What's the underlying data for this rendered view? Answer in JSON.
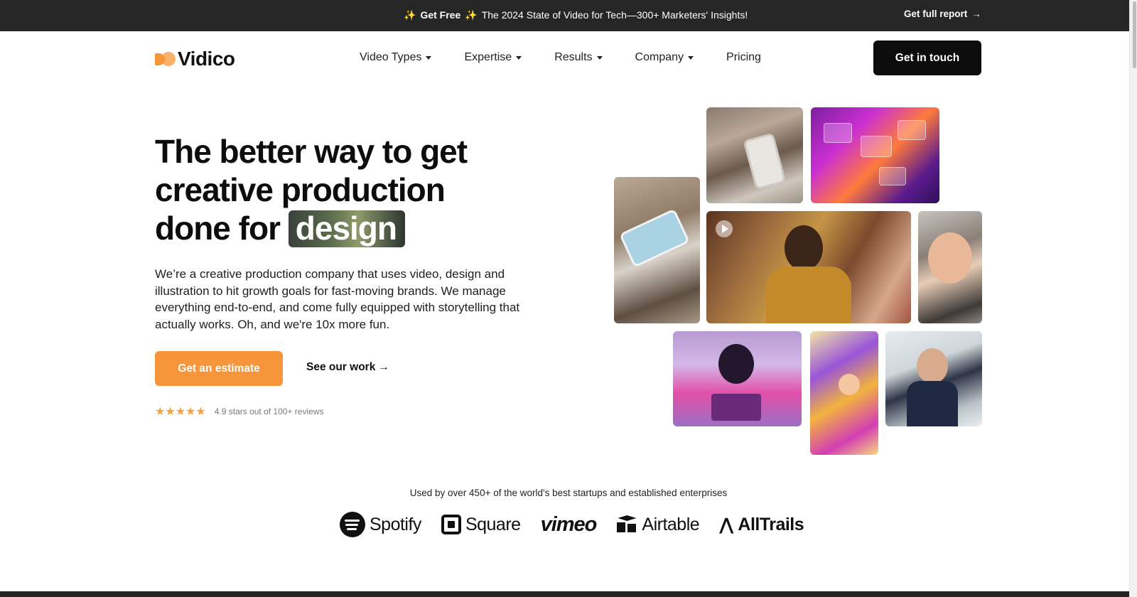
{
  "announcement": {
    "sparkle": "✨",
    "bold": "Get Free",
    "text": "The 2024 State of Video for Tech—300+ Marketers' Insights!",
    "link_label": "Get full report",
    "link_arrow": "→"
  },
  "brand": {
    "name": "Vidico",
    "accent_color": "#f7953b"
  },
  "nav": {
    "items": [
      {
        "label": "Video Types",
        "has_dropdown": true
      },
      {
        "label": "Expertise",
        "has_dropdown": true
      },
      {
        "label": "Results",
        "has_dropdown": true
      },
      {
        "label": "Company",
        "has_dropdown": true
      },
      {
        "label": "Pricing",
        "has_dropdown": false
      }
    ],
    "cta_label": "Get in touch"
  },
  "hero": {
    "title_line1": "The better way to get",
    "title_line2": "creative production",
    "title_line3_prefix": "done for ",
    "title_highlight": "design",
    "description": "We’re a creative production company that uses video, design and illustration to hit growth goals for fast-moving brands. We manage everything end-to-end, and come fully equipped with storytelling that actually works. Oh, and we're 10x more fun.",
    "primary_cta": "Get an estimate",
    "secondary_cta": "See our work",
    "secondary_arrow": "→",
    "stars": "★★★★★",
    "star_count": 5,
    "rating_text": "4.9 stars out of 100+ reviews"
  },
  "trusted": {
    "text": "Used by over 450+ of the world's best startups and established enterprises",
    "logos": [
      "Spotify",
      "Square",
      "vimeo",
      "Airtable",
      "AllTrails"
    ]
  },
  "icons": [
    "sparkle-icon",
    "arrow-right-icon",
    "chevron-down-icon",
    "play-icon",
    "star-icon"
  ]
}
